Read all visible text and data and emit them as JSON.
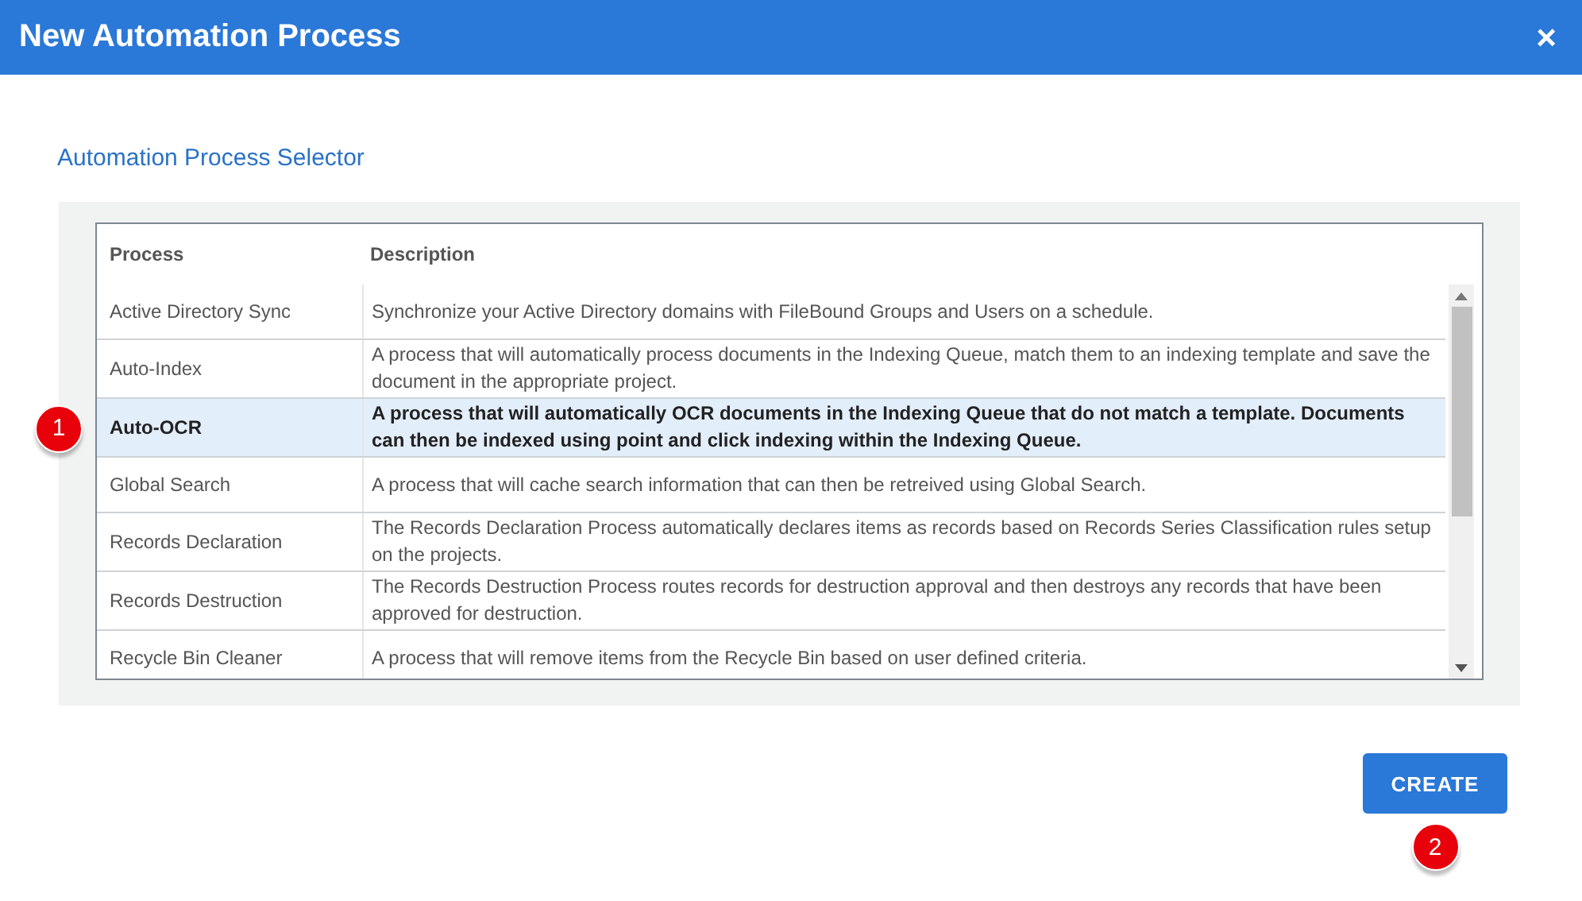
{
  "window": {
    "title": "New Automation Process",
    "close": "×"
  },
  "section_title": "Automation Process Selector",
  "table": {
    "columns": [
      "Process",
      "Description"
    ],
    "rows": [
      {
        "process": "Active Directory Sync",
        "description": "Synchronize your Active Directory domains with FileBound Groups and Users on a schedule.",
        "selected": false
      },
      {
        "process": "Auto-Index",
        "description": "A process that will automatically process documents in the Indexing Queue, match them to an indexing template and save the document in the appropriate project.",
        "selected": false
      },
      {
        "process": "Auto-OCR",
        "description": "A process that will automatically OCR documents in the Indexing Queue that do not match a template. Documents can then be indexed using point and click indexing within the Indexing Queue.",
        "selected": true
      },
      {
        "process": "Global Search",
        "description": "A process that will cache search information that can then be retreived using Global Search.",
        "selected": false
      },
      {
        "process": "Records Declaration",
        "description": "The Records Declaration Process automatically declares items as records based on Records Series Classification rules setup on the projects.",
        "selected": false
      },
      {
        "process": "Records Destruction",
        "description": "The Records Destruction Process routes records for destruction approval and then destroys any records that have been approved for destruction.",
        "selected": false
      },
      {
        "process": "Recycle Bin Cleaner",
        "description": "A process that will remove items from the Recycle Bin based on user defined criteria.",
        "selected": false
      }
    ]
  },
  "buttons": [
    {
      "label": "CREATE"
    }
  ],
  "callouts": [
    {
      "label": "1",
      "kind": "row"
    },
    {
      "label": "2",
      "kind": "button"
    }
  ]
}
